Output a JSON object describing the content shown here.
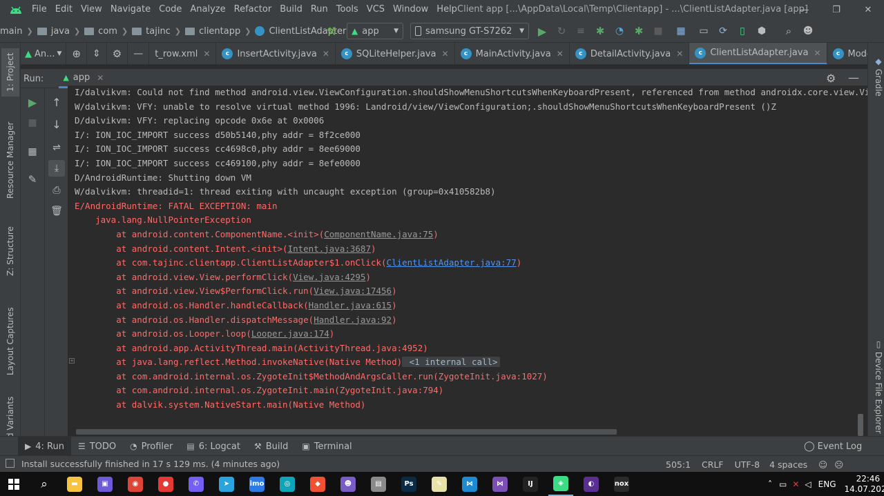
{
  "app": {
    "window_title": "Client app [...\\AppData\\Local\\Temp\\Clientapp] - ...\\ClientListAdapter.java [app]",
    "accent": "#4a88c7"
  },
  "menu": [
    "File",
    "Edit",
    "View",
    "Navigate",
    "Code",
    "Analyze",
    "Refactor",
    "Build",
    "Run",
    "Tools",
    "VCS",
    "Window",
    "Help"
  ],
  "breadcrumb": [
    "main",
    "java",
    "com",
    "tajinc",
    "clientapp",
    "ClientListAdapter"
  ],
  "toolbar": {
    "run_config": "app",
    "device": "samsung GT-S7262"
  },
  "editor_tabs": {
    "pane_label": "An...",
    "tabs": [
      {
        "label": "t_row.xml",
        "active": false,
        "icon": "xml-icon"
      },
      {
        "label": "InsertActivity.java",
        "active": false,
        "icon": "class-icon"
      },
      {
        "label": "SQLiteHelper.java",
        "active": false,
        "icon": "class-icon"
      },
      {
        "label": "MainActivity.java",
        "active": false,
        "icon": "class-icon"
      },
      {
        "label": "DetailActivity.java",
        "active": false,
        "icon": "class-icon"
      },
      {
        "label": "ClientListAdapter.java",
        "active": true,
        "icon": "class-icon"
      },
      {
        "label": "Model.java",
        "active": false,
        "icon": "class-icon"
      }
    ],
    "overflow_label": "≡"
  },
  "left_strip": [
    "1: Project",
    "Resource Manager",
    "Z: Structure",
    "Layout Captures",
    "d Variants"
  ],
  "right_strip": [
    "Gradle",
    "Device File Explorer"
  ],
  "run_panel": {
    "label": "Run:",
    "config_tab": "app"
  },
  "console": [
    {
      "segs": [
        {
          "t": "I/dalvikvm: Could not find method android.view.ViewConfiguration.shouldShowMenuShortcutsWhenKeyboardPresent, referenced from method androidx.core.view.Vi",
          "c": "gray"
        }
      ]
    },
    {
      "segs": [
        {
          "t": "W/dalvikvm: VFY: unable to resolve virtual method 1996: Landroid/view/ViewConfiguration;.shouldShowMenuShortcutsWhenKeyboardPresent ()Z",
          "c": "gray"
        }
      ]
    },
    {
      "segs": [
        {
          "t": "D/dalvikvm: VFY: replacing opcode 0x6e at 0x0006",
          "c": "gray"
        }
      ]
    },
    {
      "segs": [
        {
          "t": "I/: ION_IOC_IMPORT success d50b5140,phy addr = 8f2ce000",
          "c": "gray"
        }
      ]
    },
    {
      "segs": [
        {
          "t": "I/: ION_IOC_IMPORT success cc4698c0,phy addr = 8ee69000",
          "c": "gray"
        }
      ]
    },
    {
      "segs": [
        {
          "t": "I/: ION_IOC_IMPORT success cc469100,phy addr = 8efe0000",
          "c": "gray"
        }
      ]
    },
    {
      "segs": [
        {
          "t": "D/AndroidRuntime: Shutting down VM",
          "c": "gray"
        }
      ]
    },
    {
      "segs": [
        {
          "t": "W/dalvikvm: threadid=1: thread exiting with uncaught exception (group=0x410582b8)",
          "c": "gray"
        }
      ]
    },
    {
      "segs": [
        {
          "t": "E/AndroidRuntime: FATAL EXCEPTION: main",
          "c": "red"
        }
      ]
    },
    {
      "segs": [
        {
          "t": "    java.lang.NullPointerException",
          "c": "red"
        }
      ]
    },
    {
      "segs": [
        {
          "t": "        at android.content.ComponentName.<init>(",
          "c": "red"
        },
        {
          "t": "ComponentName.java:75",
          "c": "lnk"
        },
        {
          "t": ")",
          "c": "red"
        }
      ]
    },
    {
      "segs": [
        {
          "t": "        at android.content.Intent.<init>(",
          "c": "red"
        },
        {
          "t": "Intent.java:3687",
          "c": "lnk"
        },
        {
          "t": ")",
          "c": "red"
        }
      ]
    },
    {
      "segs": [
        {
          "t": "        at com.tajinc.clientapp.ClientListAdapter$1.onClick(",
          "c": "red"
        },
        {
          "t": "ClientListAdapter.java:77",
          "c": "lnk blue"
        },
        {
          "t": ")",
          "c": "red"
        }
      ]
    },
    {
      "segs": [
        {
          "t": "        at android.view.View.performClick(",
          "c": "red"
        },
        {
          "t": "View.java:4295",
          "c": "lnk"
        },
        {
          "t": ")",
          "c": "red"
        }
      ]
    },
    {
      "segs": [
        {
          "t": "        at android.view.View$PerformClick.run(",
          "c": "red"
        },
        {
          "t": "View.java:17456",
          "c": "lnk"
        },
        {
          "t": ")",
          "c": "red"
        }
      ]
    },
    {
      "segs": [
        {
          "t": "        at android.os.Handler.handleCallback(",
          "c": "red"
        },
        {
          "t": "Handler.java:615",
          "c": "lnk"
        },
        {
          "t": ")",
          "c": "red"
        }
      ]
    },
    {
      "segs": [
        {
          "t": "        at android.os.Handler.dispatchMessage(",
          "c": "red"
        },
        {
          "t": "Handler.java:92",
          "c": "lnk"
        },
        {
          "t": ")",
          "c": "red"
        }
      ]
    },
    {
      "segs": [
        {
          "t": "        at android.os.Looper.loop(",
          "c": "red"
        },
        {
          "t": "Looper.java:174",
          "c": "lnk"
        },
        {
          "t": ")",
          "c": "red"
        }
      ]
    },
    {
      "segs": [
        {
          "t": "        at android.app.ActivityThread.main(ActivityThread.java:4952)",
          "c": "red"
        }
      ]
    },
    {
      "segs": [
        {
          "t": "        at java.lang.reflect.Method.invokeNative(Native Method)",
          "c": "red"
        },
        {
          "t": " <1 internal call>",
          "c": "badge"
        }
      ]
    },
    {
      "segs": [
        {
          "t": "        at com.android.internal.os.ZygoteInit$MethodAndArgsCaller.run(ZygoteInit.java:1027)",
          "c": "red"
        }
      ]
    },
    {
      "segs": [
        {
          "t": "        at com.android.internal.os.ZygoteInit.main(ZygoteInit.java:794)",
          "c": "red"
        }
      ]
    },
    {
      "segs": [
        {
          "t": "        at dalvik.system.NativeStart.main(Native Method)",
          "c": "red"
        }
      ]
    },
    {
      "segs": [
        {
          "t": "",
          "c": "gray"
        }
      ]
    },
    {
      "segs": [
        {
          "t": "|",
          "c": "gray"
        }
      ]
    }
  ],
  "bottom_tabs": [
    {
      "label": "4: Run",
      "icon": "play-icon",
      "active": true
    },
    {
      "label": "TODO",
      "icon": "list-icon",
      "active": false
    },
    {
      "label": "Profiler",
      "icon": "gauge-icon",
      "active": false
    },
    {
      "label": "6: Logcat",
      "icon": "logcat-icon",
      "active": false
    },
    {
      "label": "Build",
      "icon": "hammer-icon",
      "active": false
    },
    {
      "label": "Terminal",
      "icon": "terminal-icon",
      "active": false
    }
  ],
  "event_log": "Event Log",
  "status": {
    "message": "Install successfully finished in 17 s 129 ms. (4 minutes ago)",
    "position": "505:1",
    "line_sep": "CRLF",
    "encoding": "UTF-8",
    "indent": "4 spaces"
  },
  "taskbar": {
    "lang": "ENG",
    "time": "22:46",
    "date": "14.07.2020",
    "apps": [
      {
        "name": "explorer",
        "color": "#f6c343",
        "glyph": "▬"
      },
      {
        "name": "floppy",
        "color": "#6b5bd6",
        "glyph": "▣"
      },
      {
        "name": "chrome",
        "color": "#db4437",
        "glyph": "◉"
      },
      {
        "name": "recorder",
        "color": "#e53935",
        "glyph": "●"
      },
      {
        "name": "viber",
        "color": "#7360f2",
        "glyph": "✆"
      },
      {
        "name": "telegram",
        "color": "#2aa3df",
        "glyph": "➤"
      },
      {
        "name": "imo",
        "color": "#2c7be5",
        "glyph": "imo"
      },
      {
        "name": "camera",
        "color": "#0fa5b8",
        "glyph": "◎"
      },
      {
        "name": "git",
        "color": "#f05133",
        "glyph": "◆"
      },
      {
        "name": "discord",
        "color": "#7a5cc7",
        "glyph": "☻"
      },
      {
        "name": "database",
        "color": "#8a8a8a",
        "glyph": "▤"
      },
      {
        "name": "photoshop",
        "color": "#0b2b44",
        "glyph": "Ps"
      },
      {
        "name": "notepad",
        "color": "#e9e2a8",
        "glyph": "✎"
      },
      {
        "name": "vscode",
        "color": "#1f8ad2",
        "glyph": "⋈"
      },
      {
        "name": "visualstudio",
        "color": "#7b4fb5",
        "glyph": "⋈"
      },
      {
        "name": "intellij",
        "color": "#222",
        "glyph": "IJ"
      },
      {
        "name": "androidstudio",
        "color": "#3ddc84",
        "glyph": "◈"
      },
      {
        "name": "eclipse",
        "color": "#5b2f91",
        "glyph": "◐"
      },
      {
        "name": "nox",
        "color": "#2a2a2a",
        "glyph": "nox"
      }
    ]
  }
}
